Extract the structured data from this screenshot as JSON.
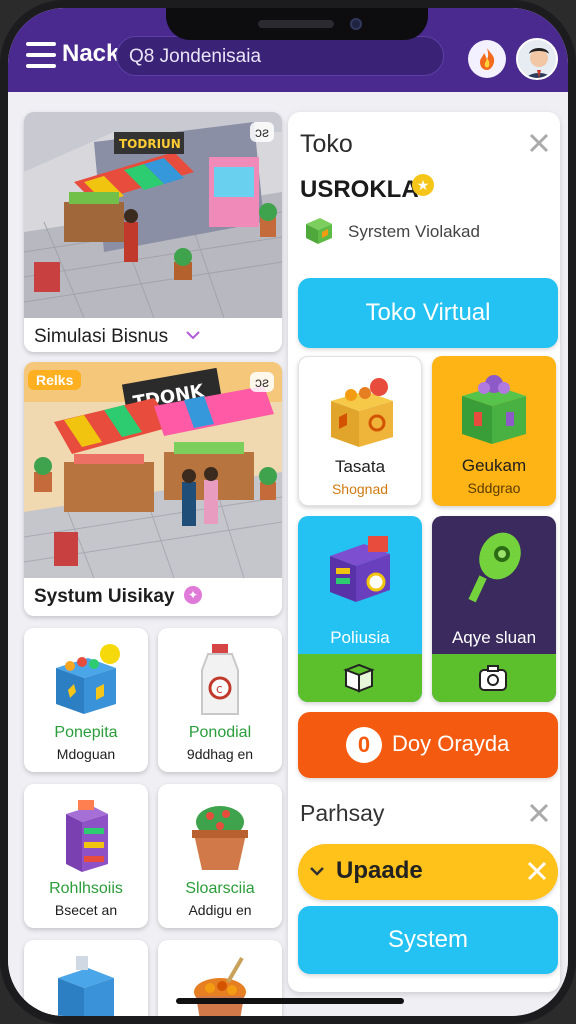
{
  "header": {
    "brand": "Nack",
    "search_text": "Q8 Jondenisaia",
    "fire_icon": "fire-icon",
    "avatar_icon": "user-avatar"
  },
  "feed": {
    "cards": [
      {
        "title": "Simulasi Bisnus",
        "badge": "ɔƨ",
        "sign": "TODRIUN"
      },
      {
        "title": "Systum Uisikay",
        "ribbon": "Relks",
        "badge": "ɔƨ",
        "sign": "TDONK"
      }
    ],
    "tiles": [
      {
        "name": "Ponepita",
        "sub": "Mdoguan",
        "icon": "gift-box-icon"
      },
      {
        "name": "Ponodial",
        "sub": "9ddhag en",
        "icon": "bottle-icon"
      },
      {
        "name": "Rohlhsoiis",
        "sub": "Bsecet an",
        "icon": "shelf-icon"
      },
      {
        "name": "Sloarsciia",
        "sub": "Addigu en",
        "icon": "plant-pot-icon"
      }
    ]
  },
  "panel": {
    "title": "Toko",
    "shop_name": "USROKLA",
    "system_label": "Syrstem Violakad",
    "primary_button": "Toko Virtual",
    "grid": [
      {
        "name": "Tasata",
        "sub": "Shognad",
        "icon": "crate-icon",
        "bg": "#ffffff"
      },
      {
        "name": "Geukam",
        "sub": "Sddgrao",
        "icon": "gift-icon",
        "bg": "#ffb416"
      },
      {
        "name": "Poliusia",
        "sub": "",
        "icon": "register-icon",
        "bg": "#23c2f2"
      },
      {
        "name": "Aqye sluan",
        "sub": "",
        "icon": "key-icon",
        "bg": "#3a2a5e"
      }
    ],
    "orange_button": {
      "value": "0",
      "label": "Doy Orayda"
    },
    "section_title": "Parhsay",
    "update_button": "Upaade",
    "system_button": "System"
  },
  "colors": {
    "topbar": "#4a2a8e",
    "cyan": "#23c2f2",
    "orange": "#f45b10",
    "yellow": "#ffc21a",
    "green": "#5cc02c"
  }
}
